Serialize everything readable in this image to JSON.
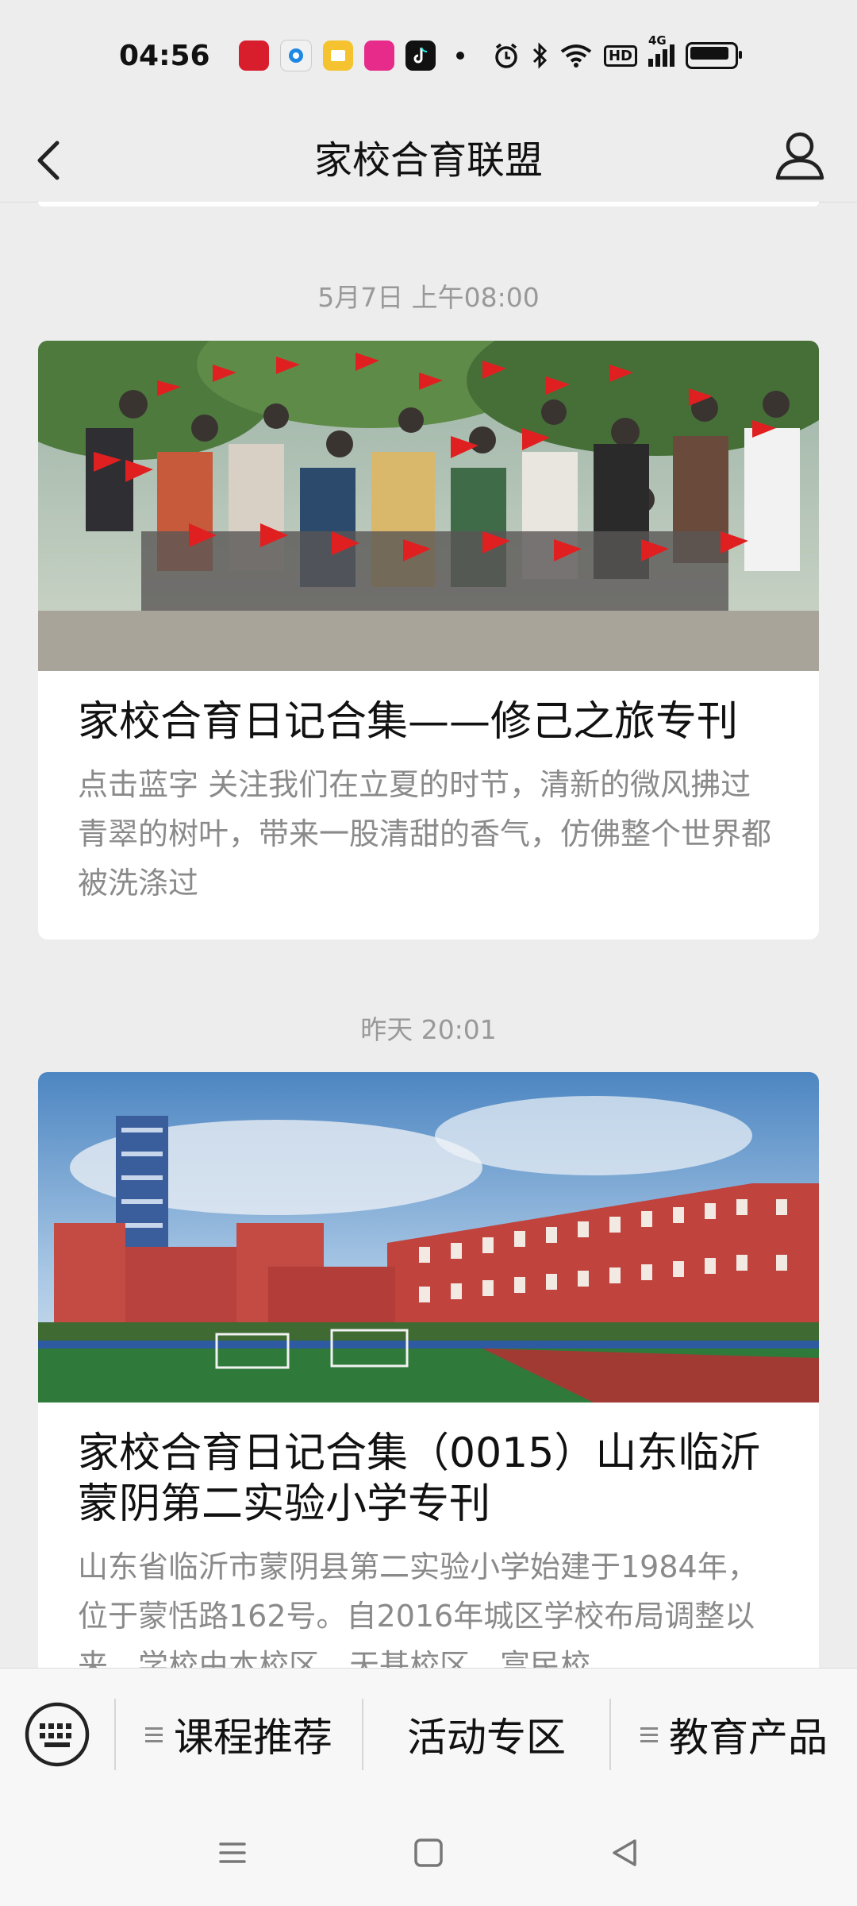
{
  "status_bar": {
    "time": "04:56",
    "app_icons": [
      "jd-app-icon",
      "browser-app-icon",
      "reader-app-icon",
      "shop-app-icon",
      "tiktok-app-icon"
    ],
    "hd_label": "HD",
    "network_label": "4G"
  },
  "nav": {
    "title": "家校合育联盟"
  },
  "articles": [
    {
      "timestamp": "5月7日 上午08:00",
      "title": "家校合育日记合集——修己之旅专刊",
      "excerpt": "点击蓝字 关注我们在立夏的时节，清新的微风拂过青翠的树叶，带来一股清甜的香气，仿佛整个世界都被洗涤过"
    },
    {
      "timestamp": "昨天 20:01",
      "title": "家校合育日记合集（0015）山东临沂蒙阴第二实验小学专刊",
      "excerpt": "山东省临沂市蒙阴县第二实验小学始建于1984年，位于蒙恬路162号。自2016年城区学校布局调整以来，学校由本校区、天基校区、富民校"
    }
  ],
  "bottom_menu": {
    "items": [
      "课程推荐",
      "活动专区",
      "教育产品"
    ]
  },
  "colors": {
    "background": "#ededed",
    "card": "#ffffff",
    "muted_text": "#999999",
    "flag_red": "#e02020"
  }
}
